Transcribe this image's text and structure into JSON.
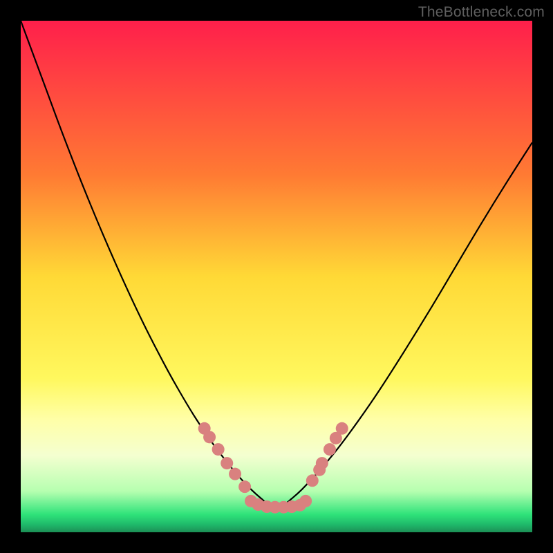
{
  "watermark": "TheBottleneck.com",
  "chart_data": {
    "type": "line",
    "title": "",
    "xlabel": "",
    "ylabel": "",
    "xlim": [
      0,
      100
    ],
    "ylim": [
      0,
      100
    ],
    "gradient_stops": [
      {
        "offset": 0,
        "color": "#ff1f4b"
      },
      {
        "offset": 0.3,
        "color": "#ff7a33"
      },
      {
        "offset": 0.5,
        "color": "#ffd936"
      },
      {
        "offset": 0.7,
        "color": "#fff85e"
      },
      {
        "offset": 0.78,
        "color": "#ffffa8"
      },
      {
        "offset": 0.85,
        "color": "#f4ffd0"
      },
      {
        "offset": 0.92,
        "color": "#b6ffb0"
      },
      {
        "offset": 0.965,
        "color": "#2fe37a"
      },
      {
        "offset": 0.985,
        "color": "#1fb96a"
      },
      {
        "offset": 1.0,
        "color": "#1c8f55"
      }
    ],
    "series": [
      {
        "name": "curve",
        "x": [
          0,
          2,
          5,
          8,
          12,
          16,
          20,
          24,
          28,
          31,
          34,
          37,
          40,
          43,
          45,
          47,
          49,
          51,
          53,
          55,
          58,
          62,
          66,
          70,
          75,
          80,
          85,
          90,
          95,
          100
        ],
        "y": [
          100,
          94.6,
          86.5,
          78.4,
          68.1,
          58.4,
          49.3,
          40.8,
          33,
          27.6,
          22.6,
          18.1,
          14.1,
          10.5,
          8.4,
          6.6,
          5.1,
          5.1,
          6.6,
          8.4,
          11.6,
          16.4,
          21.8,
          27.6,
          35.4,
          43.5,
          51.9,
          60.3,
          68.4,
          76.2
        ]
      }
    ],
    "markers": {
      "name": "dots",
      "color": "#d9817f",
      "radius": 9,
      "points": [
        {
          "x": 35.9,
          "y": 20.3
        },
        {
          "x": 36.9,
          "y": 18.6
        },
        {
          "x": 38.6,
          "y": 16.2
        },
        {
          "x": 40.3,
          "y": 13.5
        },
        {
          "x": 41.9,
          "y": 11.4
        },
        {
          "x": 43.8,
          "y": 8.9
        },
        {
          "x": 45.0,
          "y": 6.1
        },
        {
          "x": 46.4,
          "y": 5.4
        },
        {
          "x": 48.1,
          "y": 5.0
        },
        {
          "x": 49.7,
          "y": 4.9
        },
        {
          "x": 51.4,
          "y": 4.9
        },
        {
          "x": 53.0,
          "y": 5.0
        },
        {
          "x": 54.6,
          "y": 5.3
        },
        {
          "x": 55.7,
          "y": 6.1
        },
        {
          "x": 57.0,
          "y": 10.1
        },
        {
          "x": 58.4,
          "y": 12.2
        },
        {
          "x": 58.9,
          "y": 13.5
        },
        {
          "x": 60.4,
          "y": 16.2
        },
        {
          "x": 61.6,
          "y": 18.4
        },
        {
          "x": 62.8,
          "y": 20.3
        }
      ]
    }
  }
}
